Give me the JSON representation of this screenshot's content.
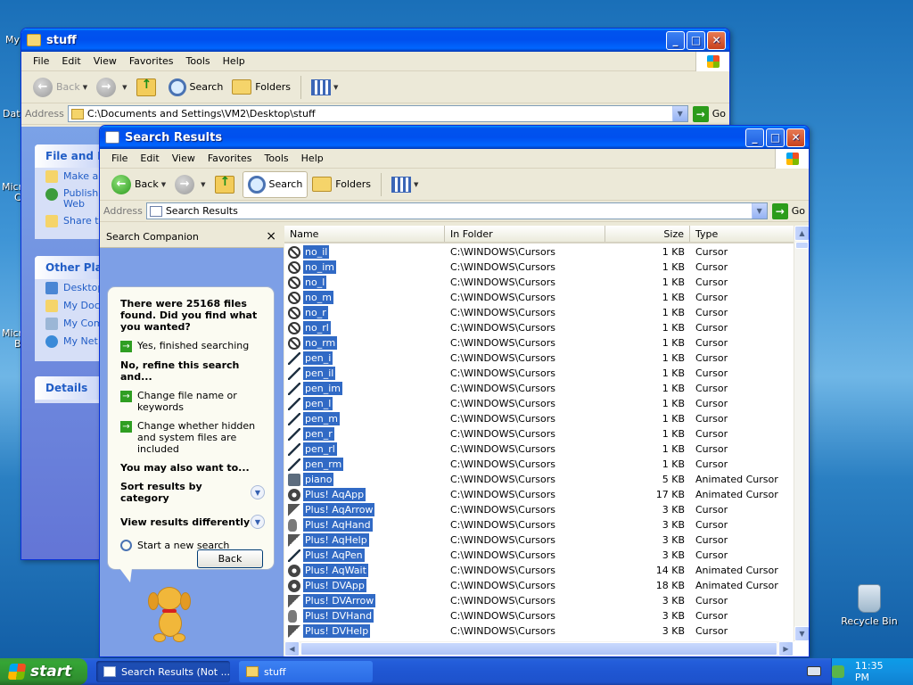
{
  "desktop": {
    "recycle_bin": "Recycle Bin",
    "partial_labels": [
      "My",
      "Dat",
      "Micr",
      "C",
      "Micr",
      "B"
    ]
  },
  "stuff_window": {
    "title": "stuff",
    "menu": [
      "File",
      "Edit",
      "View",
      "Favorites",
      "Tools",
      "Help"
    ],
    "toolbar": {
      "back": "Back",
      "search": "Search",
      "folders": "Folders"
    },
    "address_label": "Address",
    "address_value": "C:\\Documents and Settings\\VM2\\Desktop\\stuff",
    "go": "Go",
    "file_folder_tasks": {
      "title": "File and Fo",
      "items": [
        "Make a",
        "Publish Web",
        "Share t"
      ]
    },
    "other_places": {
      "title": "Other Plac",
      "items": [
        "Desktop",
        "My Doc",
        "My Com",
        "My Net"
      ]
    },
    "details": {
      "title": "Details"
    }
  },
  "search_window": {
    "title": "Search Results",
    "menu": [
      "File",
      "Edit",
      "View",
      "Favorites",
      "Tools",
      "Help"
    ],
    "toolbar": {
      "back": "Back",
      "search": "Search",
      "folders": "Folders"
    },
    "address_label": "Address",
    "address_value": "Search Results",
    "go": "Go",
    "companion": {
      "title": "Search Companion",
      "close": "×",
      "heading": "There were 25168 files found. Did you find what you wanted?",
      "yes": "Yes, finished searching",
      "refine": "No, refine this search and...",
      "change_name": "Change file name or keywords",
      "change_hidden": "Change whether hidden and system files are included",
      "also": "You may also want to...",
      "sort": "Sort results by category",
      "view": "View results differently",
      "new_search": "Start a new search",
      "back_button": "Back"
    },
    "columns": [
      "Name",
      "In Folder",
      "Size",
      "Type"
    ],
    "rows": [
      {
        "name": "no_il",
        "folder": "C:\\WINDOWS\\Cursors",
        "size": "1 KB",
        "type": "Cursor",
        "icon": "no"
      },
      {
        "name": "no_im",
        "folder": "C:\\WINDOWS\\Cursors",
        "size": "1 KB",
        "type": "Cursor",
        "icon": "no"
      },
      {
        "name": "no_l",
        "folder": "C:\\WINDOWS\\Cursors",
        "size": "1 KB",
        "type": "Cursor",
        "icon": "no"
      },
      {
        "name": "no_m",
        "folder": "C:\\WINDOWS\\Cursors",
        "size": "1 KB",
        "type": "Cursor",
        "icon": "no"
      },
      {
        "name": "no_r",
        "folder": "C:\\WINDOWS\\Cursors",
        "size": "1 KB",
        "type": "Cursor",
        "icon": "no"
      },
      {
        "name": "no_rl",
        "folder": "C:\\WINDOWS\\Cursors",
        "size": "1 KB",
        "type": "Cursor",
        "icon": "no"
      },
      {
        "name": "no_rm",
        "folder": "C:\\WINDOWS\\Cursors",
        "size": "1 KB",
        "type": "Cursor",
        "icon": "no"
      },
      {
        "name": "pen_i",
        "folder": "C:\\WINDOWS\\Cursors",
        "size": "1 KB",
        "type": "Cursor",
        "icon": "pen"
      },
      {
        "name": "pen_il",
        "folder": "C:\\WINDOWS\\Cursors",
        "size": "1 KB",
        "type": "Cursor",
        "icon": "pen"
      },
      {
        "name": "pen_im",
        "folder": "C:\\WINDOWS\\Cursors",
        "size": "1 KB",
        "type": "Cursor",
        "icon": "pen"
      },
      {
        "name": "pen_l",
        "folder": "C:\\WINDOWS\\Cursors",
        "size": "1 KB",
        "type": "Cursor",
        "icon": "pen"
      },
      {
        "name": "pen_m",
        "folder": "C:\\WINDOWS\\Cursors",
        "size": "1 KB",
        "type": "Cursor",
        "icon": "pen"
      },
      {
        "name": "pen_r",
        "folder": "C:\\WINDOWS\\Cursors",
        "size": "1 KB",
        "type": "Cursor",
        "icon": "pen"
      },
      {
        "name": "pen_rl",
        "folder": "C:\\WINDOWS\\Cursors",
        "size": "1 KB",
        "type": "Cursor",
        "icon": "pen"
      },
      {
        "name": "pen_rm",
        "folder": "C:\\WINDOWS\\Cursors",
        "size": "1 KB",
        "type": "Cursor",
        "icon": "pen"
      },
      {
        "name": "piano",
        "folder": "C:\\WINDOWS\\Cursors",
        "size": "5 KB",
        "type": "Animated Cursor",
        "icon": "pic"
      },
      {
        "name": "Plus! AqApp",
        "folder": "C:\\WINDOWS\\Cursors",
        "size": "17 KB",
        "type": "Animated Cursor",
        "icon": "gear"
      },
      {
        "name": "Plus! AqArrow",
        "folder": "C:\\WINDOWS\\Cursors",
        "size": "3 KB",
        "type": "Cursor",
        "icon": "arr"
      },
      {
        "name": "Plus! AqHand",
        "folder": "C:\\WINDOWS\\Cursors",
        "size": "3 KB",
        "type": "Cursor",
        "icon": "hand"
      },
      {
        "name": "Plus! AqHelp",
        "folder": "C:\\WINDOWS\\Cursors",
        "size": "3 KB",
        "type": "Cursor",
        "icon": "arr"
      },
      {
        "name": "Plus! AqPen",
        "folder": "C:\\WINDOWS\\Cursors",
        "size": "3 KB",
        "type": "Cursor",
        "icon": "pen"
      },
      {
        "name": "Plus! AqWait",
        "folder": "C:\\WINDOWS\\Cursors",
        "size": "14 KB",
        "type": "Animated Cursor",
        "icon": "gear"
      },
      {
        "name": "Plus! DVApp",
        "folder": "C:\\WINDOWS\\Cursors",
        "size": "18 KB",
        "type": "Animated Cursor",
        "icon": "gear"
      },
      {
        "name": "Plus! DVArrow",
        "folder": "C:\\WINDOWS\\Cursors",
        "size": "3 KB",
        "type": "Cursor",
        "icon": "arr"
      },
      {
        "name": "Plus! DVHand",
        "folder": "C:\\WINDOWS\\Cursors",
        "size": "3 KB",
        "type": "Cursor",
        "icon": "hand"
      },
      {
        "name": "Plus! DVHelp",
        "folder": "C:\\WINDOWS\\Cursors",
        "size": "3 KB",
        "type": "Cursor",
        "icon": "arr"
      }
    ]
  },
  "taskbar": {
    "start": "start",
    "tasks": [
      "Search Results (Not ...",
      "stuff"
    ],
    "clock": "11:35 PM"
  },
  "colors": {
    "selection": "#316ac5",
    "titlebar": "#0050ee",
    "start": "#2f8f2f"
  }
}
